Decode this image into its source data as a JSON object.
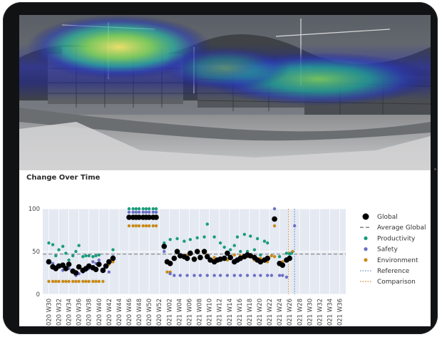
{
  "chart_data": {
    "type": "scatter",
    "title": "Change Over Time",
    "ylim": [
      0,
      100
    ],
    "yticks": [
      0,
      50,
      100
    ],
    "categories": [
      "2020 W30",
      "2020 W32",
      "2020 W34",
      "2020 W36",
      "2020 W38",
      "2020 W40",
      "2020 W42",
      "2020 W44",
      "2020 W46",
      "2020 W48",
      "2020 W50",
      "2020 W52",
      "2021 W02",
      "2021 W04",
      "2021 W06",
      "2021 W08",
      "2021 W10",
      "2021 W12",
      "2021 W14",
      "2021 W16",
      "2021 W18",
      "2021 W20",
      "2021 W22",
      "2021 W24",
      "2021 W26",
      "2021 W28",
      "2021 W30",
      "2021 W32",
      "2021 W34",
      "2021 W36"
    ],
    "series": [
      {
        "name": "Global",
        "marker": "dot-large",
        "color": "#000000",
        "values": [
          38,
          32,
          30,
          33,
          34,
          30,
          35,
          27,
          25,
          32,
          28,
          30,
          33,
          31,
          29,
          35,
          28,
          33,
          38,
          42,
          90,
          90,
          90,
          90,
          90,
          90,
          90,
          90,
          90,
          56,
          38,
          36,
          42,
          50,
          45,
          44,
          42,
          48,
          41,
          50,
          43,
          50,
          44,
          40,
          38,
          40,
          41,
          42,
          48,
          43,
          38,
          40,
          42,
          44,
          46,
          45,
          43,
          40,
          38,
          40,
          42,
          88,
          36,
          34,
          40,
          42
        ],
        "x": [
          0.0,
          0.4,
          0.7,
          1.0,
          1.4,
          1.7,
          2.0,
          2.4,
          2.7,
          3.0,
          3.4,
          3.7,
          4.0,
          4.4,
          4.7,
          5.0,
          5.4,
          5.7,
          6.0,
          6.4,
          8.0,
          8.4,
          8.7,
          9.0,
          9.4,
          9.7,
          10.0,
          10.4,
          10.7,
          11.5,
          11.8,
          12.1,
          12.5,
          12.8,
          13.1,
          13.5,
          13.8,
          14.1,
          14.5,
          14.8,
          15.1,
          15.5,
          15.8,
          16.1,
          16.5,
          16.8,
          17.1,
          17.5,
          17.8,
          18.1,
          18.5,
          18.8,
          19.1,
          19.5,
          19.8,
          20.1,
          20.5,
          20.8,
          21.1,
          21.5,
          21.8,
          22.5,
          23.0,
          23.3,
          23.7,
          24.0
        ]
      },
      {
        "name": "Average Global",
        "marker": "dash-line",
        "color": "#8a8a8a",
        "values": [
          47
        ]
      },
      {
        "name": "Productivity",
        "marker": "dot",
        "color": "#1a9c7b",
        "values": [
          60,
          58,
          45,
          52,
          56,
          48,
          40,
          45,
          50,
          57,
          44,
          45,
          45,
          44,
          45,
          46,
          52,
          100,
          100,
          100,
          100,
          100,
          100,
          100,
          100,
          100,
          60,
          64,
          65,
          62,
          64,
          66,
          67,
          82,
          67,
          60,
          55,
          52,
          57,
          67,
          50,
          70,
          50,
          68,
          52,
          65,
          46,
          62,
          60,
          44,
          48,
          47,
          48
        ],
        "x": [
          0.0,
          0.4,
          0.7,
          1.0,
          1.4,
          1.7,
          2.0,
          2.4,
          2.7,
          3.0,
          3.4,
          3.7,
          4.0,
          4.4,
          4.7,
          5.0,
          6.4,
          8.0,
          8.4,
          8.7,
          9.0,
          9.4,
          9.7,
          10.0,
          10.4,
          10.7,
          11.5,
          12.1,
          12.8,
          13.5,
          14.1,
          14.8,
          15.5,
          15.8,
          16.5,
          17.1,
          17.5,
          18.1,
          18.5,
          18.8,
          19.1,
          19.5,
          19.8,
          20.1,
          20.5,
          20.8,
          21.1,
          21.5,
          21.8,
          23.0,
          23.7,
          24.0,
          24.2
        ]
      },
      {
        "name": "Safety",
        "marker": "dot",
        "color": "#6c6fc4",
        "values": [
          38,
          36,
          32,
          34,
          28,
          30,
          30,
          26,
          22,
          24,
          26,
          28,
          30,
          38,
          36,
          40,
          26,
          44,
          96,
          96,
          96,
          96,
          96,
          96,
          96,
          96,
          96,
          50,
          24,
          22,
          22,
          22,
          22,
          22,
          22,
          22,
          22,
          22,
          22,
          22,
          22,
          22,
          22,
          22,
          22,
          100,
          22,
          22,
          20,
          80
        ],
        "x": [
          0.0,
          0.4,
          0.7,
          1.0,
          1.4,
          1.7,
          2.0,
          2.4,
          2.7,
          3.0,
          3.4,
          3.7,
          4.0,
          4.4,
          4.7,
          5.0,
          6.0,
          6.4,
          8.0,
          8.4,
          8.7,
          9.0,
          9.4,
          9.7,
          10.0,
          10.4,
          10.7,
          11.5,
          12.1,
          12.5,
          13.1,
          13.8,
          14.5,
          15.1,
          15.8,
          16.5,
          17.1,
          17.8,
          18.5,
          19.1,
          19.8,
          20.5,
          21.1,
          21.8,
          22.2,
          22.5,
          23.0,
          23.3,
          23.7,
          24.5
        ]
      },
      {
        "name": "Environment",
        "marker": "dot",
        "color": "#c98a17",
        "values": [
          15,
          15,
          15,
          15,
          15,
          15,
          15,
          15,
          15,
          15,
          15,
          15,
          15,
          15,
          15,
          15,
          15,
          35,
          38,
          80,
          80,
          80,
          80,
          80,
          80,
          80,
          80,
          80,
          26,
          26,
          42,
          44,
          45,
          40,
          44,
          46,
          43,
          42,
          40,
          46,
          45,
          44,
          40,
          42,
          40,
          38,
          45,
          44,
          80,
          38,
          40,
          48,
          50
        ],
        "x": [
          0.0,
          0.4,
          0.7,
          1.0,
          1.4,
          1.7,
          2.0,
          2.4,
          2.7,
          3.0,
          3.4,
          3.7,
          4.0,
          4.4,
          4.7,
          5.0,
          5.4,
          6.0,
          6.4,
          8.0,
          8.4,
          8.7,
          9.0,
          9.4,
          9.7,
          10.0,
          10.4,
          10.7,
          11.8,
          12.1,
          12.5,
          13.1,
          13.8,
          14.5,
          15.1,
          15.8,
          16.5,
          17.1,
          17.8,
          18.5,
          19.1,
          19.8,
          20.5,
          21.1,
          21.5,
          21.8,
          22.2,
          22.5,
          22.5,
          23.3,
          23.7,
          24.0,
          24.3
        ]
      },
      {
        "name": "Reference",
        "marker": "dotted-line",
        "color": "#7d9fc8",
        "x_at": 24.5
      },
      {
        "name": "Comparison",
        "marker": "dotted-line",
        "color": "#e0a050",
        "x_at": 23.9
      }
    ],
    "legend_position": "right",
    "grid": true
  }
}
